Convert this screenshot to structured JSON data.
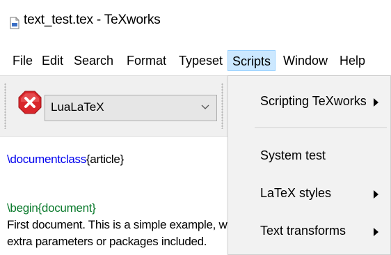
{
  "window": {
    "title": "text_test.tex - TeXworks",
    "icon": "tex-document-icon"
  },
  "menubar": {
    "items": [
      {
        "label": "File"
      },
      {
        "label": "Edit"
      },
      {
        "label": "Search"
      },
      {
        "label": "Format"
      },
      {
        "label": "Typeset"
      },
      {
        "label": "Scripts",
        "active": true
      },
      {
        "label": "Window"
      },
      {
        "label": "Help"
      }
    ]
  },
  "toolbar": {
    "typeset_button_icon": "stop-icon",
    "engine": {
      "selected": "LuaLaTeX"
    }
  },
  "editor": {
    "line1": {
      "command": "\\documentclass",
      "argument": "{article}"
    },
    "line2": {
      "command": "\\begin",
      "argument": "{document}"
    },
    "line3": "First document. This is a simple example, with n",
    "line4": "extra parameters or packages included."
  },
  "scripts_menu": {
    "items": [
      {
        "label": "Scripting TeXworks",
        "submenu": true
      },
      {
        "label": "System test",
        "submenu": false
      },
      {
        "label": "LaTeX styles",
        "submenu": true
      },
      {
        "label": "Text transforms",
        "submenu": true
      }
    ]
  },
  "colors": {
    "menu_active_bg": "#cce8ff",
    "syntax_command": "#0000ee",
    "syntax_environment": "#0a7a2c",
    "stop_button": "#d9262b"
  }
}
